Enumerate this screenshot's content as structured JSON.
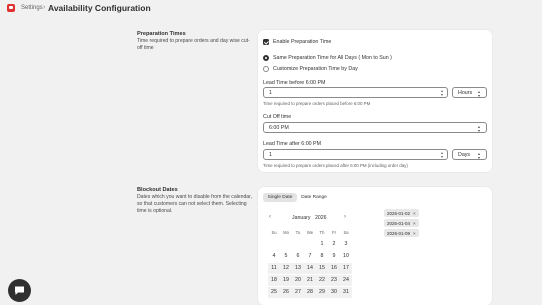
{
  "header": {
    "breadcrumb": "Settings",
    "separator": "›",
    "title": "Availability Configuration"
  },
  "preparation": {
    "title": "Preparation Times",
    "description": "Time required to prepare orders and day wise cut-off time",
    "enable_label": "Enable Preparation Time",
    "enable_checked": true,
    "options": [
      {
        "label": "Same Preparation Time for All Days ( Mon to Sun )",
        "selected": true
      },
      {
        "label": "Customize Preparation Time by Day",
        "selected": false
      }
    ],
    "lead_before": {
      "label": "Lead Time before 6:00 PM",
      "value": "1",
      "unit": "Hours",
      "hint": "Time required to prepare orders placed before 6:00 PM"
    },
    "cutoff": {
      "label": "Cut Off time",
      "value": "6:00 PM"
    },
    "lead_after": {
      "label": "Lead Time after 6:00 PM",
      "value": "1",
      "unit": "Days",
      "hint": "Time required to prepare orders placed after 6:00 PM (including order day)"
    }
  },
  "blockout": {
    "title": "Blockout Dates",
    "description": "Dates which you want to disable from the calendar, so that customers can not select them. Selecting time is optional.",
    "tabs": [
      {
        "label": "Single Date",
        "active": true
      },
      {
        "label": "Date Range",
        "active": false
      }
    ],
    "calendar": {
      "prev": "‹",
      "next": "›",
      "month": "January",
      "year": "2026",
      "weekdays": [
        "Su",
        "Mo",
        "Tu",
        "We",
        "Th",
        "Fr",
        "Sa"
      ],
      "weeks": [
        [
          "",
          "",
          "",
          "",
          "1",
          "2",
          "3"
        ],
        [
          "4",
          "5",
          "6",
          "7",
          "8",
          "9",
          "10"
        ],
        [
          "11",
          "12",
          "13",
          "14",
          "15",
          "16",
          "17"
        ],
        [
          "18",
          "19",
          "20",
          "21",
          "22",
          "23",
          "24"
        ],
        [
          "25",
          "26",
          "27",
          "28",
          "29",
          "30",
          "31"
        ]
      ]
    },
    "selected_dates": [
      "2026-01-02",
      "2026-01-04",
      "2026-01-09"
    ],
    "remove_glyph": "×"
  },
  "colors": {
    "accent": "#303030",
    "logo": "#e03131",
    "background": "#f1f1f1"
  },
  "icons": {
    "logo": "app-logo-icon",
    "chat": "chat-bubble-icon",
    "spinner": "spinner-icon",
    "select": "chevron-updown-icon"
  }
}
